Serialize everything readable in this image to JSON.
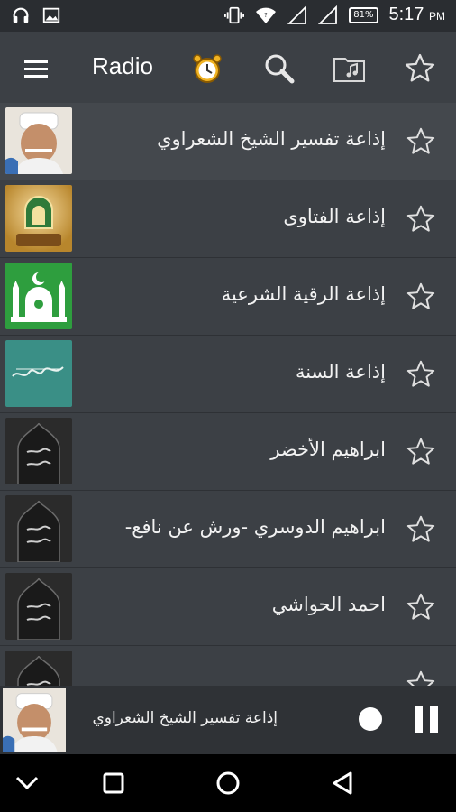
{
  "status": {
    "time": "5:17",
    "ampm": "PM",
    "battery": "81%"
  },
  "toolbar": {
    "title": "Radio",
    "icons": [
      "menu-icon",
      "alarm-clock-icon",
      "search-icon",
      "music-folder-icon",
      "star-icon"
    ]
  },
  "stations": [
    {
      "label": "إذاعة تفسير الشيخ الشعراوي",
      "thumb": "sheikh-portrait",
      "active": true
    },
    {
      "label": "إذاعة الفتاوى",
      "thumb": "fatawa-logo",
      "active": false
    },
    {
      "label": "إذاعة الرقية الشرعية",
      "thumb": "mosque-logo",
      "active": false
    },
    {
      "label": "إذاعة السنة",
      "thumb": "sunnah-logo",
      "active": false
    },
    {
      "label": "ابراهيم الأخضر",
      "thumb": "quran-logo",
      "active": false
    },
    {
      "label": "ابراهيم الدوسري -ورش عن نافع-",
      "thumb": "quran-logo",
      "active": false
    },
    {
      "label": "احمد الحواشي",
      "thumb": "quran-logo",
      "active": false
    },
    {
      "label": "",
      "thumb": "quran-logo",
      "active": false
    }
  ],
  "player": {
    "title": "إذاعة تفسير الشيخ الشعراوي"
  },
  "colors": {
    "background": "#3c4045",
    "statusbar": "#2a2d31",
    "player": "#2f3236",
    "navbar": "#000000"
  }
}
